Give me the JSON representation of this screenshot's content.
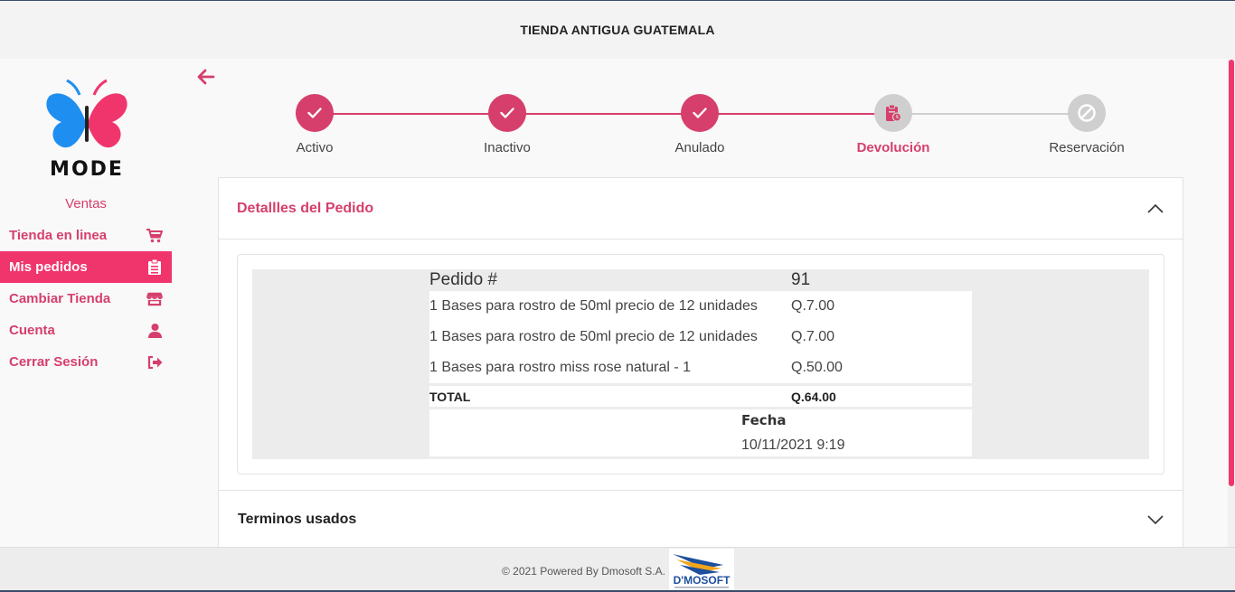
{
  "header": {
    "title": "TIENDA ANTIGUA GUATEMALA"
  },
  "brand": {
    "logo_text": "MODE",
    "accent": "#d63f6c",
    "active_bg": "#f0356d"
  },
  "sidebar": {
    "section_title": "Ventas",
    "items": [
      {
        "label": "Tienda en linea",
        "icon": "cart-icon",
        "active": false
      },
      {
        "label": "Mis pedidos",
        "icon": "clipboard-list-icon",
        "active": true
      },
      {
        "label": "Cambiar Tienda",
        "icon": "store-icon",
        "active": false
      },
      {
        "label": "Cuenta",
        "icon": "user-icon",
        "active": false
      },
      {
        "label": "Cerrar Sesión",
        "icon": "sign-out-icon",
        "active": false
      }
    ]
  },
  "stepper": {
    "steps": [
      {
        "label": "Activo",
        "status": "done",
        "icon": "check-icon"
      },
      {
        "label": "Inactivo",
        "status": "done",
        "icon": "check-icon"
      },
      {
        "label": "Anulado",
        "status": "done",
        "icon": "check-icon"
      },
      {
        "label": "Devolución",
        "status": "current",
        "icon": "clipboard-clock-icon"
      },
      {
        "label": "Reservación",
        "status": "todo",
        "icon": "ban-icon"
      }
    ]
  },
  "details": {
    "title": "Detallles del Pedido",
    "order_label": "Pedido #",
    "order_number": "91",
    "items": [
      {
        "description": "1 Bases para rostro de 50ml precio de 12 unidades",
        "price": "Q.7.00"
      },
      {
        "description": "1 Bases para rostro de 50ml precio de 12 unidades",
        "price": "Q.7.00"
      },
      {
        "description": "1 Bases para rostro miss rose natural - 1",
        "price": "Q.50.00"
      }
    ],
    "total_label": "TOTAL",
    "total_value": "Q.64.00",
    "date_label": "Fecha",
    "date_value": "10/11/2021 9:19"
  },
  "terms": {
    "title": "Terminos usados"
  },
  "footer": {
    "text": "© 2021 Powered By Dmosoft S.A.",
    "logo_text": "D'MOSOFT"
  }
}
